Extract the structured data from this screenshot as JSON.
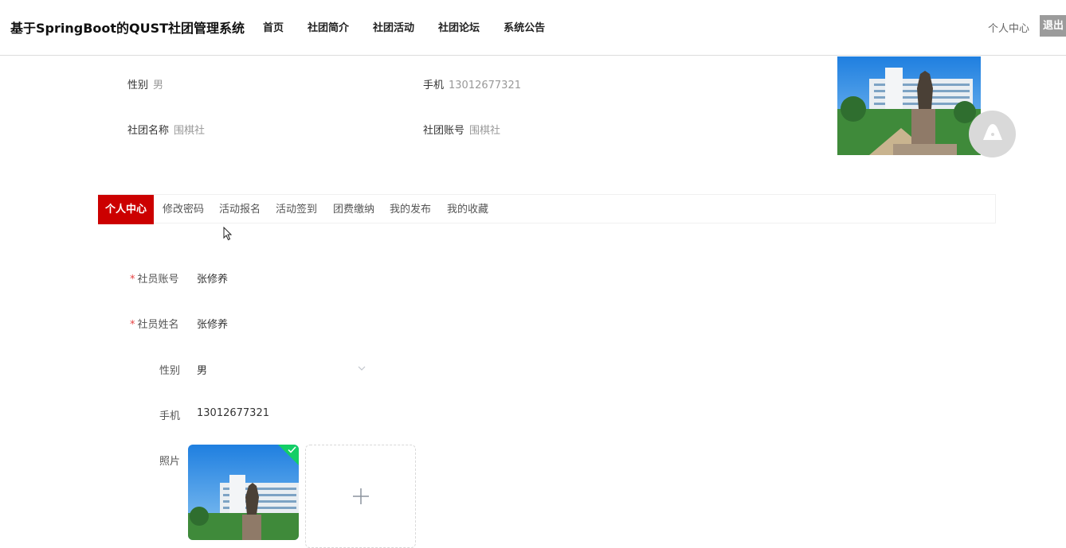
{
  "header": {
    "brand": "基于SpringBoot的QUST社团管理系统",
    "nav": [
      "首页",
      "社团简介",
      "社团活动",
      "社团论坛",
      "系统公告"
    ],
    "user_center": "个人中心",
    "logout": "退出"
  },
  "profile_summary": {
    "gender_label": "性别",
    "gender_value": "男",
    "phone_label": "手机",
    "phone_value": "13012677321",
    "club_name_label": "社团名称",
    "club_name_value": "围棋社",
    "club_account_label": "社团账号",
    "club_account_value": "围棋社"
  },
  "tabs": [
    "个人中心",
    "修改密码",
    "活动报名",
    "活动签到",
    "团费缴纳",
    "我的发布",
    "我的收藏"
  ],
  "active_tab": "个人中心",
  "form": {
    "required_mark": "*",
    "account_label": "社员账号",
    "account_value": "张修养",
    "name_label": "社员姓名",
    "name_value": "张修养",
    "gender_label": "性别",
    "gender_value": "男",
    "phone_label": "手机",
    "phone_value": "13012677321",
    "photo_label": "照片"
  },
  "icons": {
    "float_button": "bell-icon",
    "select_arrow": "chevron-down-icon",
    "upload_success": "check-icon",
    "upload_add": "plus-icon"
  },
  "colors": {
    "active_tab": "#cc0000",
    "logout_bg": "#9b9b9b",
    "upload_success": "#13ce66",
    "required": "#e64242"
  }
}
